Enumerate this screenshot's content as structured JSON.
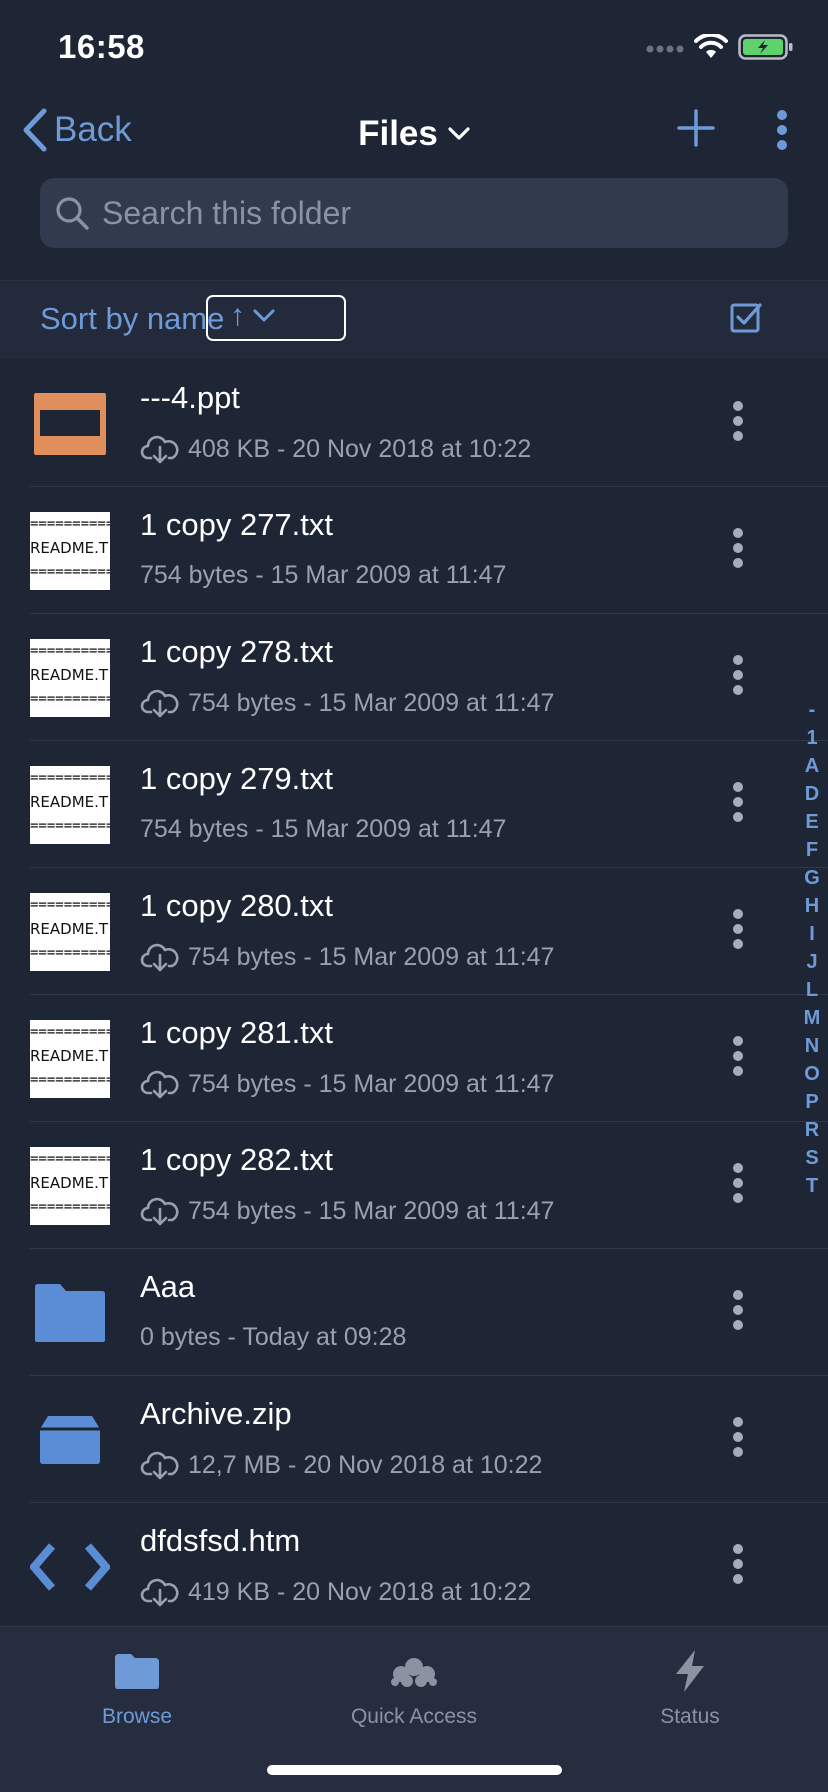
{
  "status_bar": {
    "time": "16:58"
  },
  "navbar": {
    "back_label": "Back",
    "title": "Files"
  },
  "search": {
    "placeholder": "Search this folder"
  },
  "sort": {
    "label": "Sort by name",
    "direction": "↑"
  },
  "files": [
    {
      "name": "---4.ppt",
      "meta": "408 KB - 20 Nov 2018 at 10:22",
      "kind": "ppt",
      "cloud": true
    },
    {
      "name": "1 copy 277.txt",
      "meta": "754 bytes - 15 Mar 2009 at 11:47",
      "kind": "readme",
      "cloud": false
    },
    {
      "name": "1 copy 278.txt",
      "meta": "754 bytes - 15 Mar 2009 at 11:47",
      "kind": "readme",
      "cloud": true
    },
    {
      "name": "1 copy 279.txt",
      "meta": "754 bytes - 15 Mar 2009 at 11:47",
      "kind": "readme",
      "cloud": false
    },
    {
      "name": "1 copy 280.txt",
      "meta": "754 bytes - 15 Mar 2009 at 11:47",
      "kind": "readme",
      "cloud": true
    },
    {
      "name": "1 copy 281.txt",
      "meta": "754 bytes - 15 Mar 2009 at 11:47",
      "kind": "readme",
      "cloud": true
    },
    {
      "name": "1 copy 282.txt",
      "meta": "754 bytes - 15 Mar 2009 at 11:47",
      "kind": "readme",
      "cloud": true
    },
    {
      "name": "Aaa",
      "meta": "0 bytes - Today at 09:28",
      "kind": "folder",
      "cloud": false
    },
    {
      "name": "Archive.zip",
      "meta": "12,7 MB - 20 Nov 2018 at 10:22",
      "kind": "archive",
      "cloud": true
    },
    {
      "name": "dfdsfsd.htm",
      "meta": "419 KB - 20 Nov 2018 at 10:22",
      "kind": "code",
      "cloud": true
    }
  ],
  "readme_thumb": {
    "line": "===========",
    "text": "README.T"
  },
  "index_letters": [
    "-",
    "1",
    "A",
    "D",
    "E",
    "F",
    "G",
    "H",
    "I",
    "J",
    "L",
    "M",
    "N",
    "O",
    "P",
    "R",
    "S",
    "T"
  ],
  "tabs": {
    "browse": "Browse",
    "quick_access": "Quick Access",
    "status": "Status"
  },
  "colors": {
    "background": "#1e2535",
    "accent": "#6f9ad8",
    "text_secondary": "#9aa1ae",
    "ppt_orange": "#e08e5b",
    "battery_green": "#5fd36b"
  }
}
